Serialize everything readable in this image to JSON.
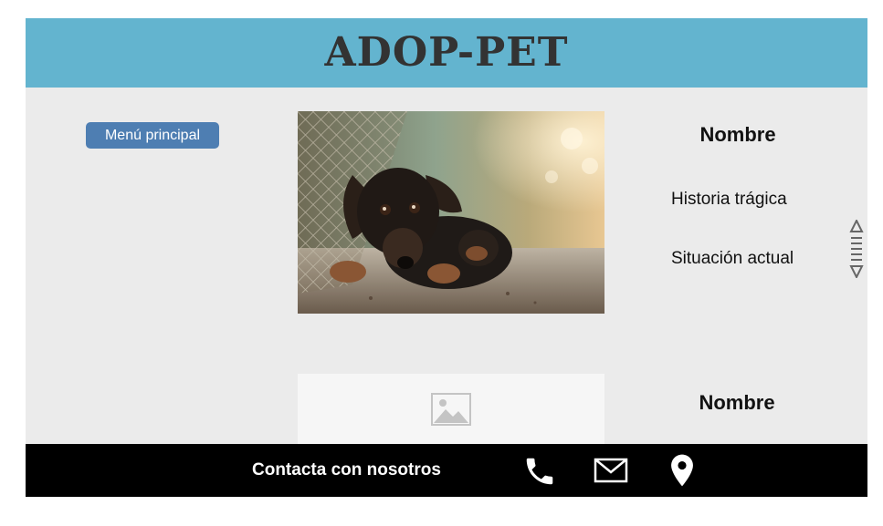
{
  "header": {
    "title": "ADOP-PET"
  },
  "nav": {
    "main_menu_label": "Menú principal"
  },
  "pets": [
    {
      "name_label": "Nombre",
      "story_label": "Historia trágica",
      "status_label": "Situación actual"
    },
    {
      "name_label": "Nombre"
    }
  ],
  "footer": {
    "contact_label": "Contacta con nosotros",
    "icons": [
      "phone-icon",
      "mail-icon",
      "location-pin-icon"
    ]
  },
  "colors": {
    "header_bg": "#63b4cf",
    "button_bg": "#4e7eb2",
    "content_bg": "#ebebeb",
    "footer_bg": "#000000"
  }
}
